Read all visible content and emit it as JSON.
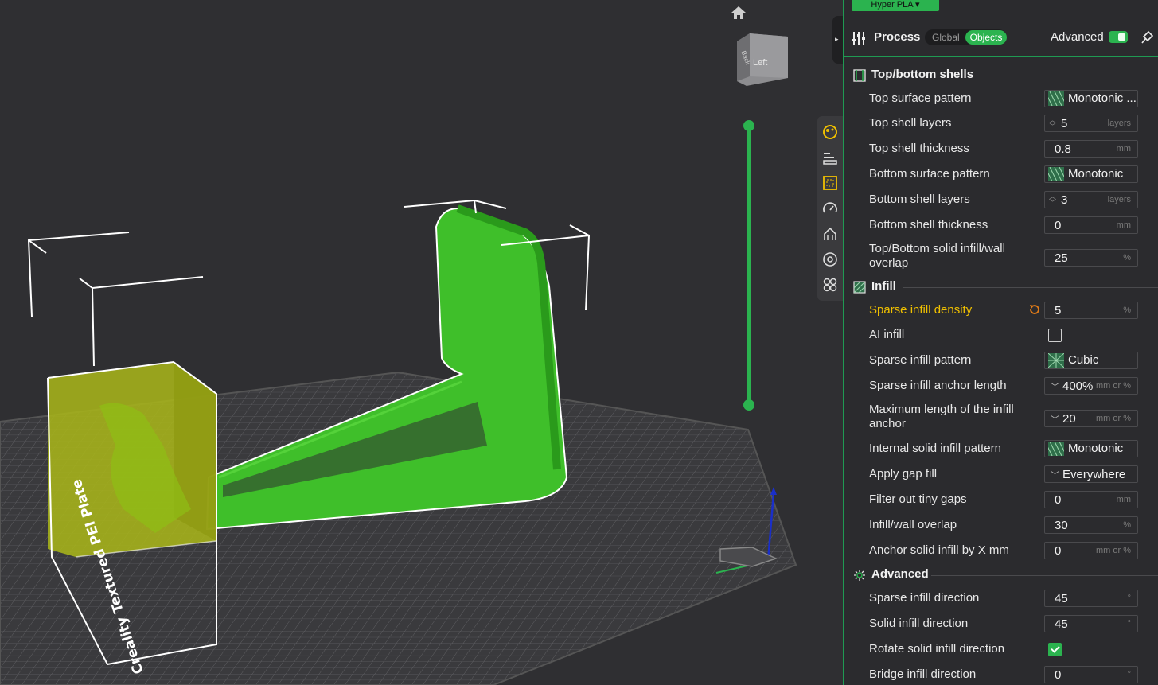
{
  "viewport": {
    "bed_label": "Creality Textured PEI Plate",
    "view_cube": {
      "face_left": "Left",
      "face_back": "Back"
    },
    "icons": [
      "home-icon",
      "view-cube",
      "layer-slider"
    ]
  },
  "side_toolbar": {
    "icons": [
      "quality-icon",
      "strength-icon",
      "speed-icon",
      "support-icon",
      "others-icon",
      "multimaterial-icon",
      "special-mode-icon"
    ]
  },
  "top_bar": {
    "filament": "Hyper PLA ▾"
  },
  "process": {
    "title": "Process",
    "scope_global": "Global",
    "scope_objects": "Objects",
    "advanced_label": "Advanced",
    "advanced_enabled": true
  },
  "sections": {
    "shells": {
      "title": "Top/bottom shells",
      "icon": "shells-icon"
    },
    "infill": {
      "title": "Infill",
      "icon": "infill-icon"
    },
    "advanced": {
      "title": "Advanced",
      "icon": "advanced-icon"
    }
  },
  "settings": {
    "top_surface_pattern": {
      "label": "Top surface pattern",
      "value": "Monotonic ..."
    },
    "top_shell_layers": {
      "label": "Top shell layers",
      "value": "5",
      "unit": "layers"
    },
    "top_shell_thickness": {
      "label": "Top shell thickness",
      "value": "0.8",
      "unit": "mm"
    },
    "bottom_surface_pattern": {
      "label": "Bottom surface pattern",
      "value": "Monotonic"
    },
    "bottom_shell_layers": {
      "label": "Bottom shell layers",
      "value": "3",
      "unit": "layers"
    },
    "bottom_shell_thickness": {
      "label": "Bottom shell thickness",
      "value": "0",
      "unit": "mm"
    },
    "solid_infill_overlap": {
      "label": "Top/Bottom solid infill/wall overlap",
      "value": "25",
      "unit": "%"
    },
    "sparse_infill_density": {
      "label": "Sparse infill density",
      "value": "5",
      "unit": "%"
    },
    "ai_infill": {
      "label": "AI infill",
      "checked": false
    },
    "sparse_infill_pattern": {
      "label": "Sparse infill pattern",
      "value": "Cubic"
    },
    "sparse_infill_anchor_length": {
      "label": "Sparse infill anchor length",
      "value": "400%",
      "unit": "mm or %"
    },
    "max_infill_anchor": {
      "label": "Maximum length of the infill anchor",
      "value": "20",
      "unit": "mm or %"
    },
    "internal_solid_infill_pattern": {
      "label": "Internal solid infill pattern",
      "value": "Monotonic"
    },
    "apply_gap_fill": {
      "label": "Apply gap fill",
      "value": "Everywhere"
    },
    "filter_tiny_gaps": {
      "label": "Filter out tiny gaps",
      "value": "0",
      "unit": "mm"
    },
    "infill_wall_overlap": {
      "label": "Infill/wall overlap",
      "value": "30",
      "unit": "%"
    },
    "anchor_solid_infill": {
      "label": "Anchor solid infill by X mm",
      "value": "0",
      "unit": "mm or %"
    },
    "sparse_infill_direction": {
      "label": "Sparse infill direction",
      "value": "45",
      "unit": "°"
    },
    "solid_infill_direction": {
      "label": "Solid infill direction",
      "value": "45",
      "unit": "°"
    },
    "rotate_solid_infill": {
      "label": "Rotate solid infill direction",
      "checked": true
    },
    "bridge_infill_direction": {
      "label": "Bridge infill direction",
      "value": "0",
      "unit": "°"
    }
  },
  "colors": {
    "accent": "#2bb34f",
    "highlight": "#f0c000",
    "panel_bg": "#2b2b2e",
    "viewport_bg": "#2f2f32"
  }
}
